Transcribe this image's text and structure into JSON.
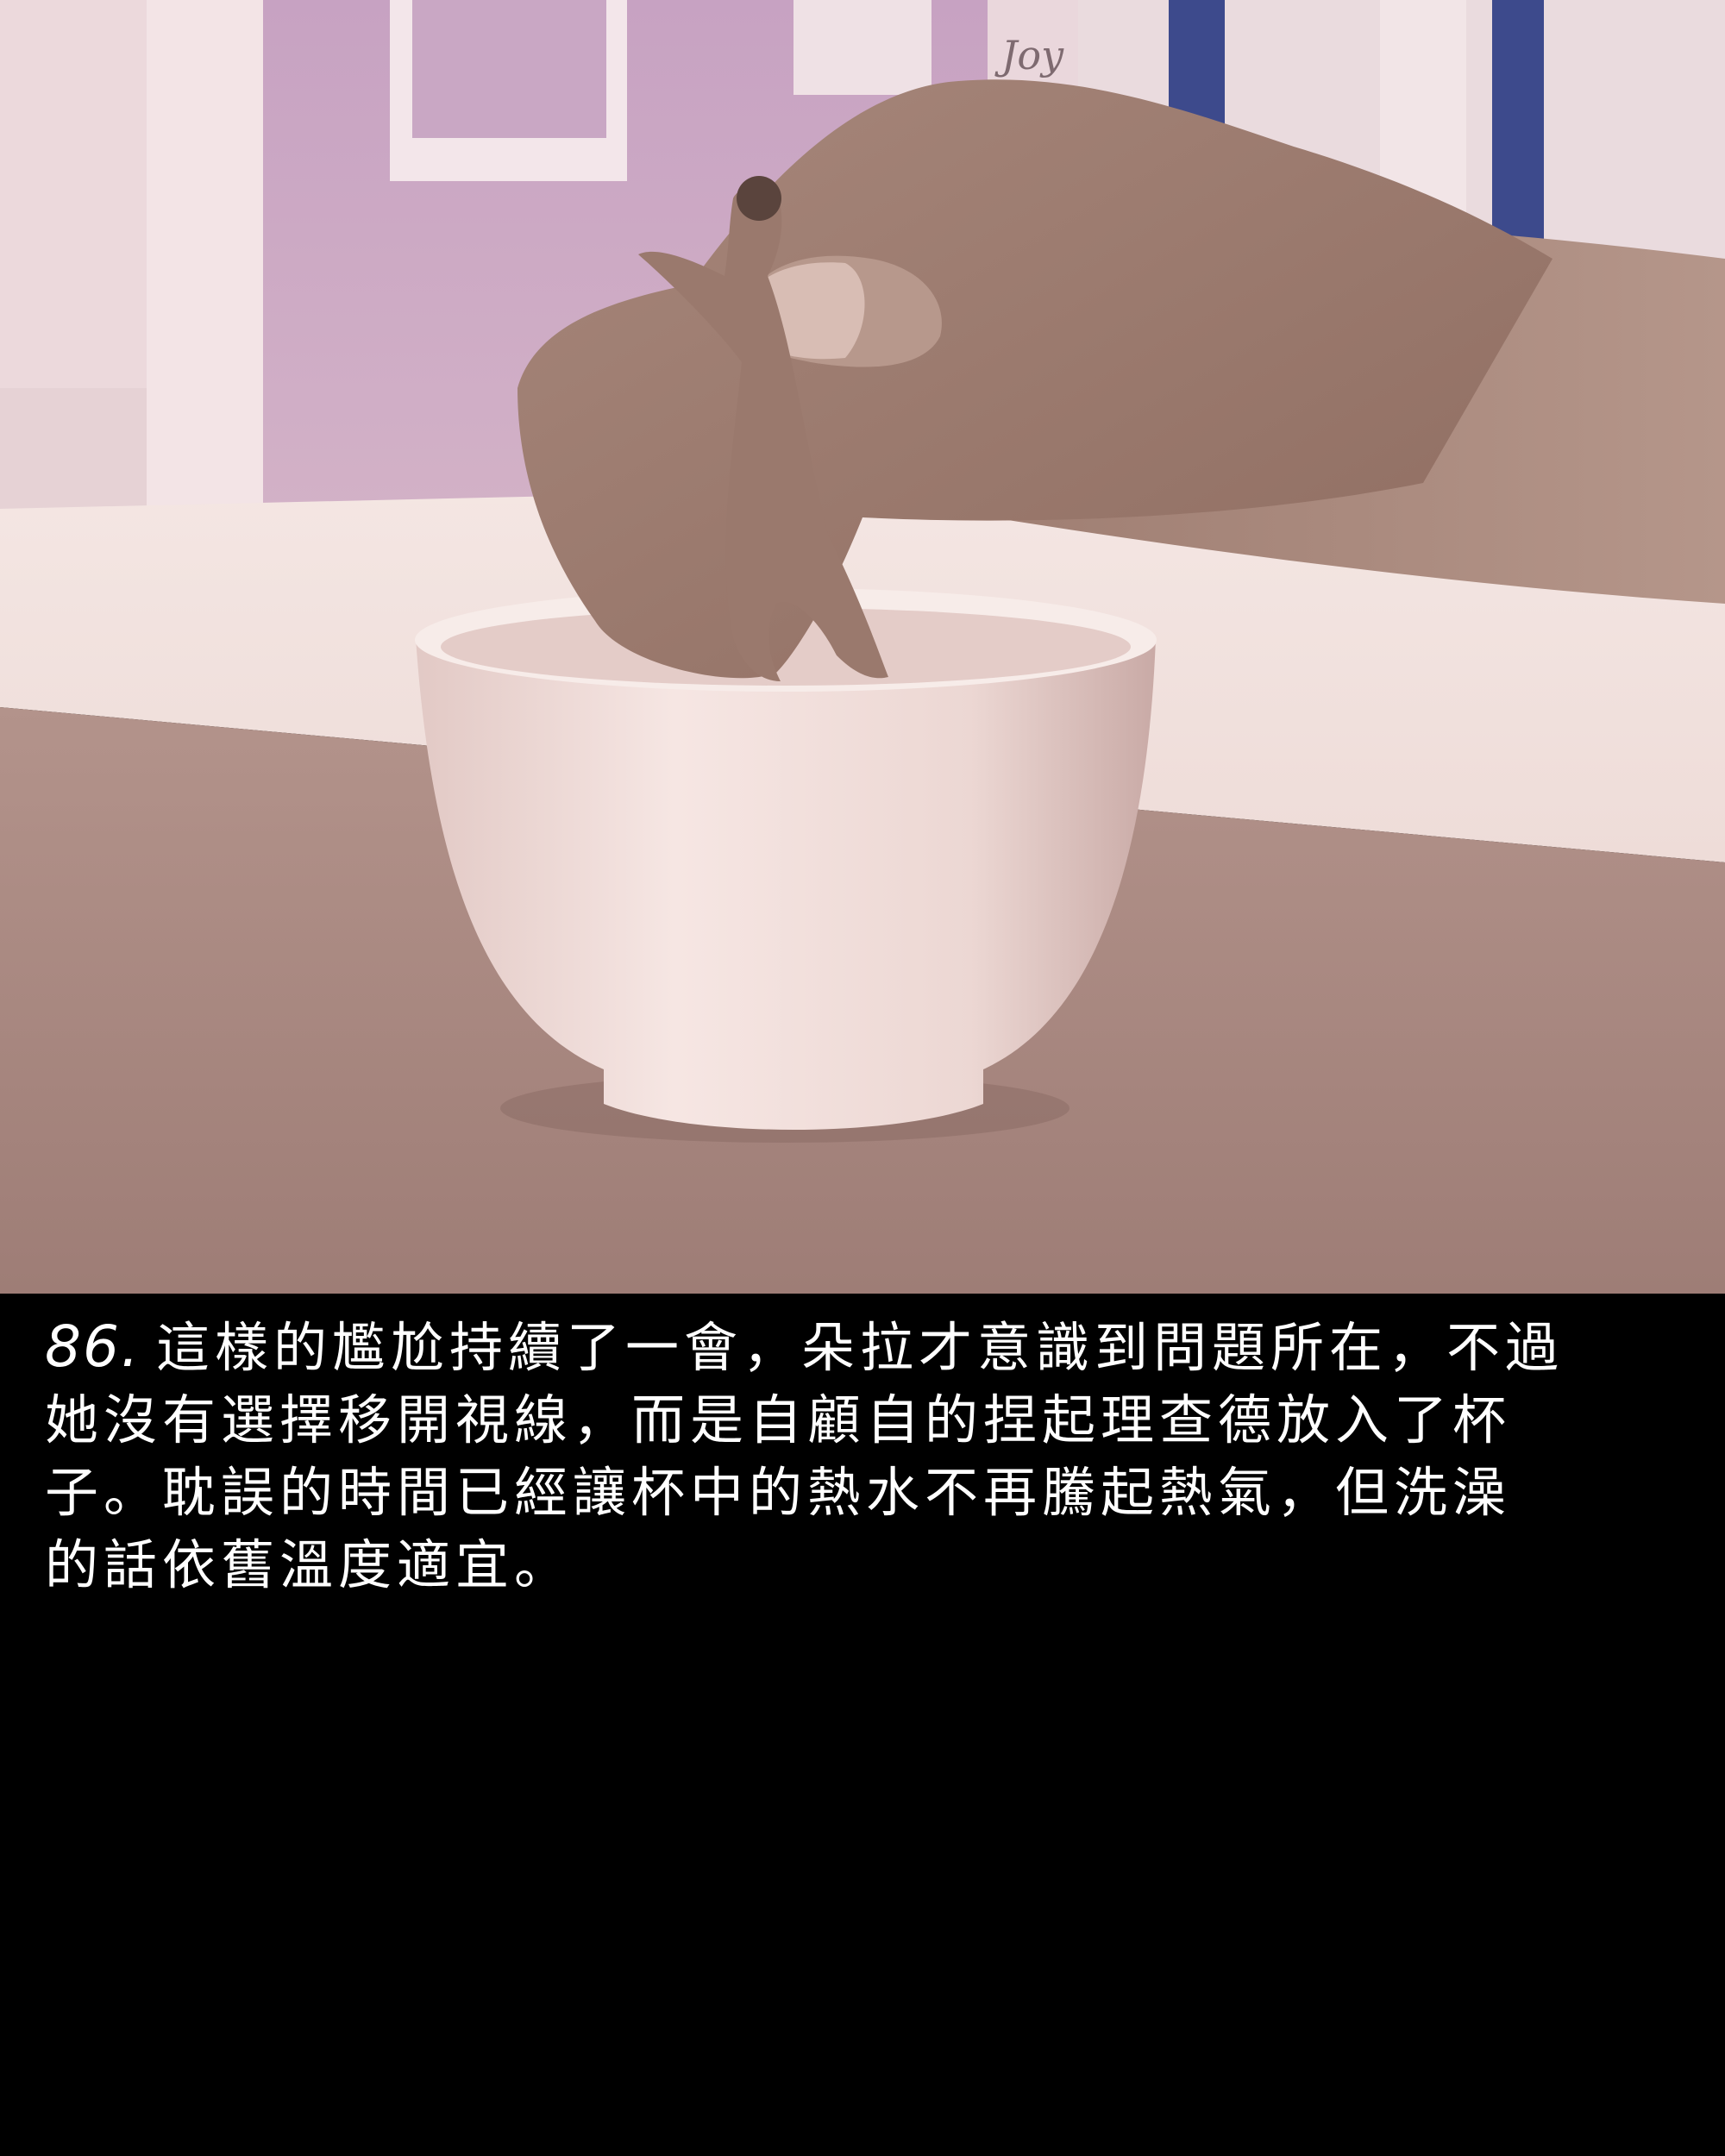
{
  "panel": {
    "number": "86.",
    "lines": [
      "這樣的尷尬持續了一會，朵拉才意識到問題所在，不過",
      "她沒有選擇移開視線，而是自顧自的捏起理查德放入了杯",
      "子。耽誤的時間已經讓杯中的熱水不再騰起熱氣，但洗澡",
      "的話依舊溫度適宜。"
    ]
  },
  "scene": {
    "wall_sign_text": "Joy",
    "colors": {
      "wall": "#c8a6c0",
      "table": "#a8877f",
      "cup": "#f1dcd8",
      "hand": "#a07f72",
      "caption_background": "#000000",
      "caption_text": "#ffffff"
    }
  }
}
